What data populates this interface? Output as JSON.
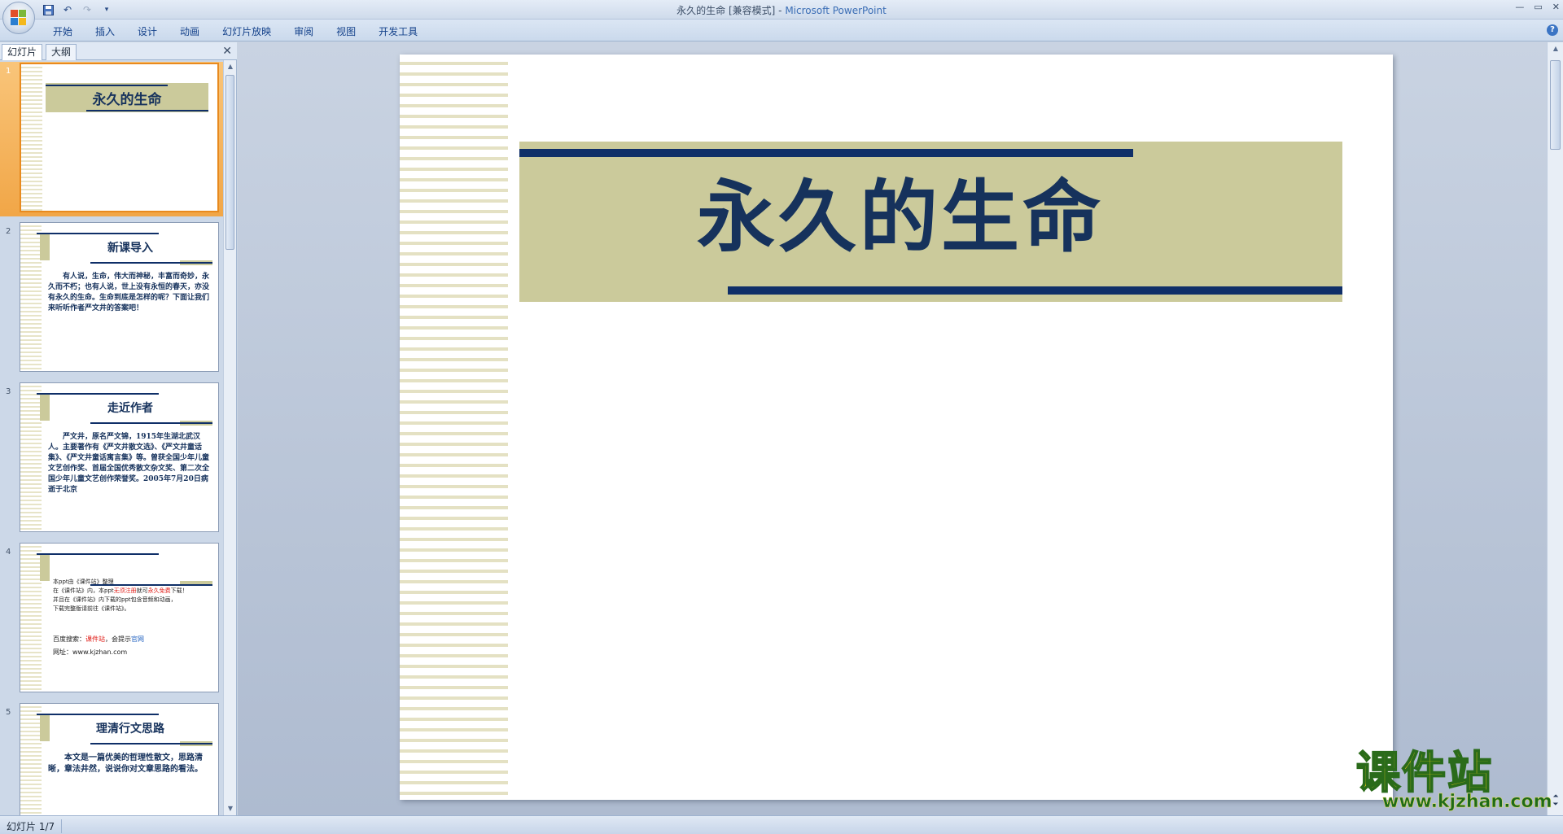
{
  "window": {
    "title_doc": "永久的生命 [兼容模式] - ",
    "title_app": "Microsoft PowerPoint",
    "controls": [
      "—",
      "▭",
      "✕"
    ]
  },
  "ribbon": {
    "tabs": [
      "开始",
      "插入",
      "设计",
      "动画",
      "幻灯片放映",
      "审阅",
      "视图",
      "开发工具"
    ],
    "help": "?"
  },
  "panel": {
    "tabs": [
      "幻灯片",
      "大纲"
    ],
    "close": "✕"
  },
  "slides": [
    {
      "num": "1",
      "title": "永久的生命"
    },
    {
      "num": "2",
      "title": "新课导入",
      "body": "有人说，生命，伟大而神秘，丰富而奇妙，永久而不朽；也有人说，世上没有永恒的春天，亦没有永久的生命。生命到底是怎样的呢？下面让我们来听听作者严文井的答案吧！"
    },
    {
      "num": "3",
      "title": "走近作者",
      "body": "严文井，原名严文锦，1915年生湖北武汉人。主要著作有《严文井散文选》、《严文井童话集》、《严文井童话寓言集》等。曾获全国少年儿童文艺创作奖、首届全国优秀散文杂文奖、第二次全国少年儿童文艺创作荣誉奖。2005年7月20日病逝于北京"
    },
    {
      "num": "4",
      "lines": [
        "本ppt由《课件站》整理",
        "在《课件站》内，本ppt",
        "无须注册",
        "就可",
        "永久免费",
        "下载！",
        "并且在《课件站》内下载的ppt包含音频和动画，",
        "下载完整版请前往《课件站》。",
        "百度搜索：",
        "课件站",
        "，会提示",
        "官网",
        "网址：www.kjzhan.com"
      ]
    },
    {
      "num": "5",
      "title": "理清行文思路",
      "body": "本文是一篇优美的哲理性散文，思路清晰，章法井然，说说你对文章思路的看法。"
    }
  ],
  "main_slide": {
    "title": "永久的生命"
  },
  "status": {
    "text": "幻灯片 1/7"
  },
  "watermark": {
    "name": "课件站",
    "url": "www.kjzhan.com"
  },
  "colors": {
    "olive": "#cbca9b",
    "navy": "#0f2f68",
    "selection": "#f1a647"
  }
}
